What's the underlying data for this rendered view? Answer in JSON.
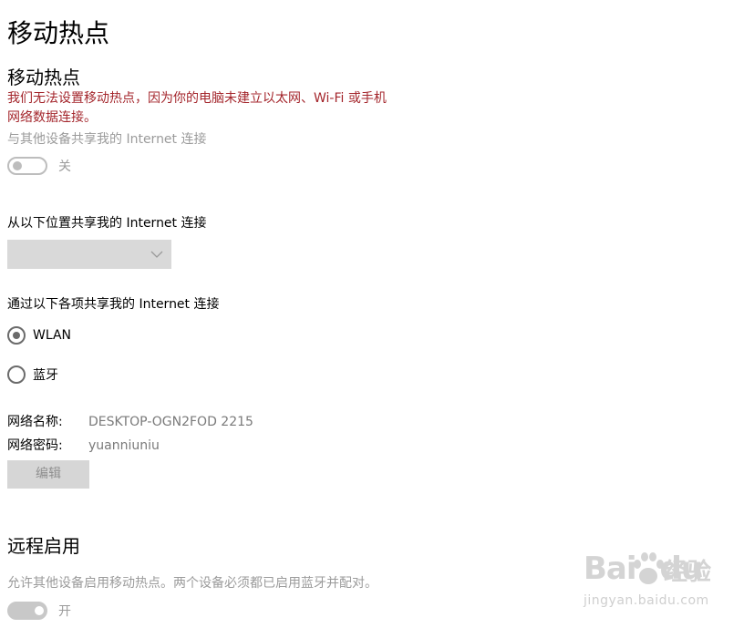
{
  "page": {
    "title": "移动热点"
  },
  "hotspot": {
    "section_title": "移动热点",
    "error_line1": "我们无法设置移动热点，因为你的电脑未建立以太网、Wi-Fi 或手机",
    "error_line2": "网络数据连接。",
    "share_label": "与其他设备共享我的 Internet 连接",
    "toggle_state": "off",
    "toggle_label": "关"
  },
  "share_from": {
    "label": "从以下位置共享我的 Internet 连接",
    "selected_value": ""
  },
  "share_over": {
    "label": "通过以下各项共享我的 Internet 连接",
    "options": [
      {
        "label": "WLAN",
        "selected": true
      },
      {
        "label": "蓝牙",
        "selected": false
      }
    ]
  },
  "network": {
    "name_label": "网络名称:",
    "name_value": "DESKTOP-OGN2FOD 2215",
    "password_label": "网络密码:",
    "password_value": "yuanniuniu",
    "edit_label": "编辑"
  },
  "remote": {
    "section_title": "远程启用",
    "description": "允许其他设备启用移动热点。两个设备必须都已启用蓝牙并配对。",
    "toggle_state": "on",
    "toggle_label": "开"
  },
  "watermark": {
    "logo_text": "Bai",
    "logo_text2": "du",
    "jingyan_text": "经验",
    "url_text": "jingyan.baidu.com"
  }
}
